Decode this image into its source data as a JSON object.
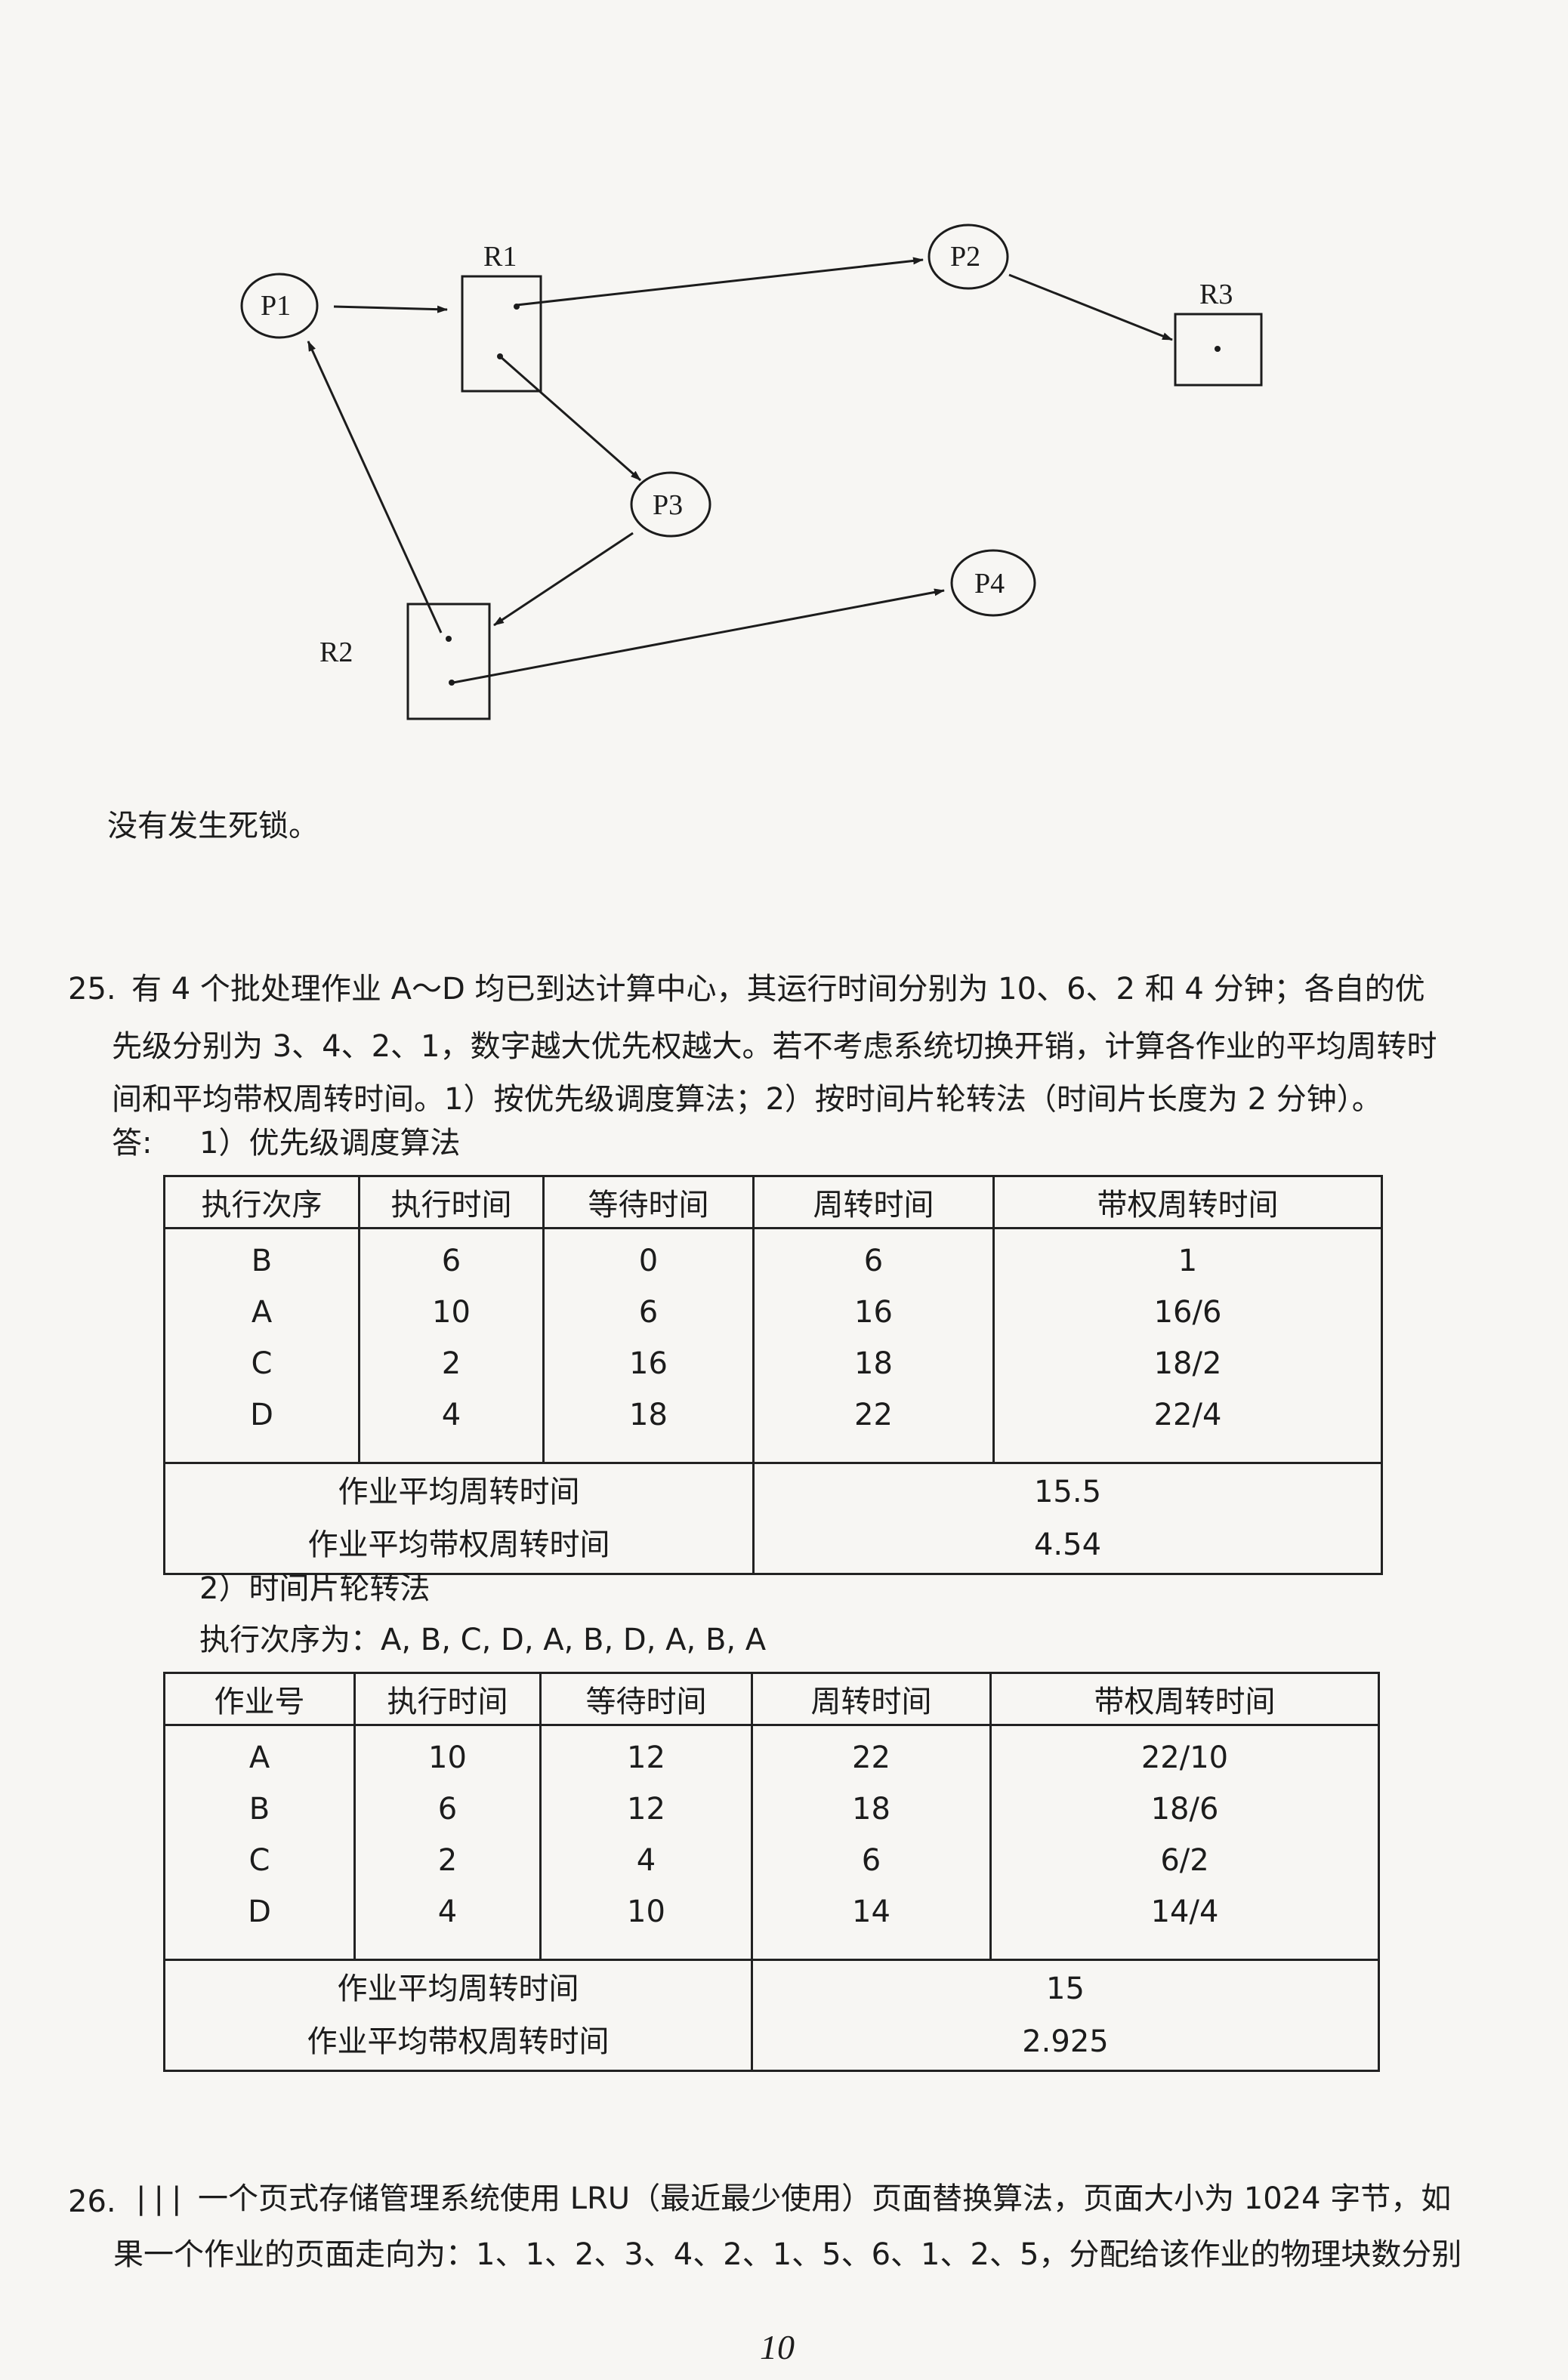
{
  "diagram": {
    "processes": [
      "P1",
      "P2",
      "P3",
      "P4"
    ],
    "resources": [
      "R1",
      "R2",
      "R3"
    ]
  },
  "q24_conclusion": "没有发生死锁。",
  "q25": {
    "number": "25.",
    "question_lines": [
      "有 4 个批处理作业 A～D 均已到达计算中心，其运行时间分别为 10、6、2 和 4 分钟；各自的优",
      "先级分别为 3、4、2、1，数字越大优先权越大。若不考虑系统切换开销，计算各作业的平均周转时",
      "间和平均带权周转时间。1）按优先级调度算法；2）按时间片轮转法（时间片长度为 2 分钟）。"
    ],
    "answer_prefix": "答:",
    "part1_title": "1）优先级调度算法",
    "table1": {
      "headers": [
        "执行次序",
        "执行时间",
        "等待时间",
        "周转时间",
        "带权周转时间"
      ],
      "columns": [
        [
          "B",
          "A",
          "C",
          "D"
        ],
        [
          "6",
          "10",
          "2",
          "4"
        ],
        [
          "0",
          "6",
          "16",
          "18"
        ],
        [
          "6",
          "16",
          "18",
          "22"
        ],
        [
          "1",
          "16/6",
          "18/2",
          "22/4"
        ]
      ],
      "avg_turnaround_label": "作业平均周转时间",
      "avg_weighted_label": "作业平均带权周转时间",
      "avg_turnaround": "15.5",
      "avg_weighted": "4.54"
    },
    "part2_title": "2）时间片轮转法",
    "exec_order": "执行次序为：A, B, C, D, A, B, D, A, B, A",
    "table2": {
      "headers": [
        "作业号",
        "执行时间",
        "等待时间",
        "周转时间",
        "带权周转时间"
      ],
      "columns": [
        [
          "A",
          "B",
          "C",
          "D"
        ],
        [
          "10",
          "6",
          "2",
          "4"
        ],
        [
          "12",
          "12",
          "4",
          "10"
        ],
        [
          "22",
          "18",
          "6",
          "14"
        ],
        [
          "22/10",
          "18/6",
          "6/2",
          "14/4"
        ]
      ],
      "avg_turnaround_label": "作业平均周转时间",
      "avg_weighted_label": "作业平均带权周转时间",
      "avg_turnaround": "15",
      "avg_weighted": "2.925"
    }
  },
  "q26": {
    "number": "26.",
    "marks": "|||",
    "lines": [
      "一个页式存储管理系统使用 LRU（最近最少使用）页面替换算法，页面大小为 1024 字节，如",
      "果一个作业的页面走向为：1、1、2、3、4、2、1、5、6、1、2、5，分配给该作业的物理块数分别"
    ]
  },
  "page_number": "10"
}
